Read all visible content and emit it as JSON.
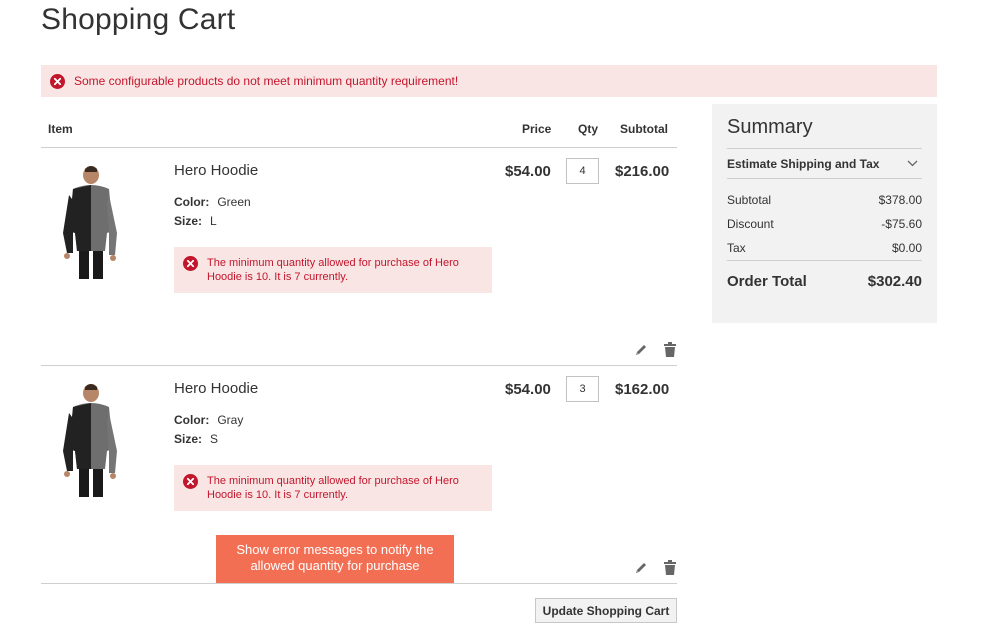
{
  "page": {
    "title": "Shopping Cart"
  },
  "global_error": {
    "message": "Some configurable products do not meet minimum quantity requirement!"
  },
  "table": {
    "headers": {
      "item": "Item",
      "price": "Price",
      "qty": "Qty",
      "subtotal": "Subtotal"
    }
  },
  "items": [
    {
      "name": "Hero Hoodie",
      "color_label": "Color:",
      "color": "Green",
      "size_label": "Size:",
      "size": "L",
      "error": "The minimum quantity allowed for purchase of Hero Hoodie is 10. It is 7 currently.",
      "price": "$54.00",
      "qty": "4",
      "subtotal": "$216.00"
    },
    {
      "name": "Hero Hoodie",
      "color_label": "Color:",
      "color": "Gray",
      "size_label": "Size:",
      "size": "S",
      "error": "The minimum quantity allowed for purchase of Hero Hoodie is 10. It is 7 currently.",
      "price": "$54.00",
      "qty": "3",
      "subtotal": "$162.00"
    }
  ],
  "callout": {
    "text": "Show error messages to notify the allowed quantity for purchase"
  },
  "update_button": {
    "label": "Update Shopping Cart"
  },
  "summary": {
    "title": "Summary",
    "estimate_label": "Estimate Shipping and Tax",
    "subtotal_label": "Subtotal",
    "subtotal_value": "$378.00",
    "discount_label": "Discount",
    "discount_value": "-$75.60",
    "tax_label": "Tax",
    "tax_value": "$0.00",
    "total_label": "Order Total",
    "total_value": "$302.40"
  },
  "colors": {
    "error": "#c2162c",
    "error_bg": "#fae5e5",
    "callout": "#f26f54",
    "summary_bg": "#f2f2f2"
  },
  "icons": {
    "error": "error-circle-x-icon",
    "edit": "pencil-icon",
    "delete": "trash-icon",
    "expand": "chevron-down-icon"
  }
}
